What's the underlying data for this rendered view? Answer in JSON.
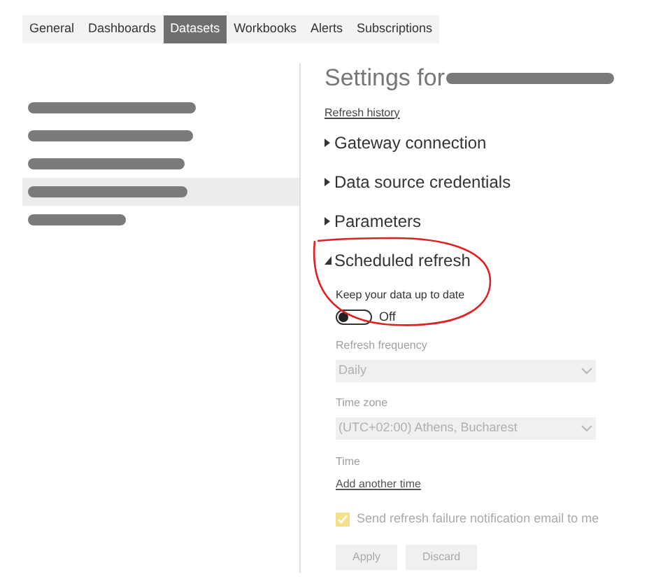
{
  "tabs": [
    {
      "label": "General",
      "selected": false
    },
    {
      "label": "Dashboards",
      "selected": false
    },
    {
      "label": "Datasets",
      "selected": true
    },
    {
      "label": "Workbooks",
      "selected": false
    },
    {
      "label": "Alerts",
      "selected": false
    },
    {
      "label": "Subscriptions",
      "selected": false
    }
  ],
  "datasets": [
    {
      "selected": false
    },
    {
      "selected": false
    },
    {
      "selected": false
    },
    {
      "selected": true
    },
    {
      "selected": false
    }
  ],
  "settings": {
    "title": "Settings for",
    "refresh_history": "Refresh history",
    "sections": [
      {
        "label": "Gateway connection",
        "expanded": false
      },
      {
        "label": "Data source credentials",
        "expanded": false
      },
      {
        "label": "Parameters",
        "expanded": false
      },
      {
        "label": "Scheduled refresh",
        "expanded": true
      }
    ],
    "keep_up_to_date": {
      "label": "Keep your data up to date",
      "on": false,
      "state_text": "Off"
    },
    "refresh_frequency": {
      "label": "Refresh frequency",
      "value": "Daily",
      "disabled": true
    },
    "time_zone": {
      "label": "Time zone",
      "value": "(UTC+02:00) Athens, Bucharest",
      "disabled": true
    },
    "time": {
      "label": "Time",
      "add_link": "Add another time"
    },
    "notify": {
      "label": "Send refresh failure notification email to me",
      "checked": true,
      "disabled": true
    },
    "buttons": [
      "Apply",
      "Discard"
    ]
  }
}
